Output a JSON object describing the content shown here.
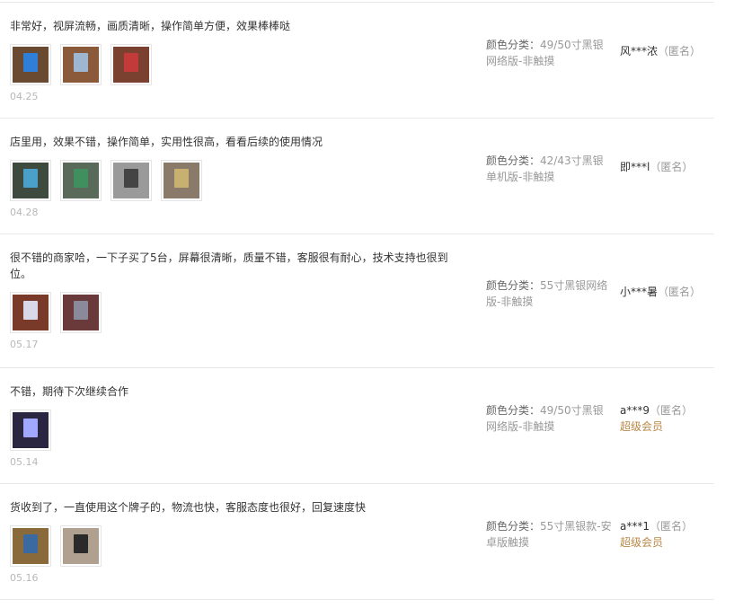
{
  "colors": {
    "vip": "#b98947",
    "meta": "#999999",
    "divider": "#e8e8e8"
  },
  "reviews": [
    {
      "text": "非常好，视屏流畅，画质清晰，操作简单方便，效果棒棒哒",
      "date": "04.25",
      "sku_label": "颜色分类：",
      "sku_value": "49/50寸黑银网络版-非触摸",
      "user": "风***浓",
      "anon": "（匿名）",
      "vip": "",
      "photos": [
        {
          "bg": "#6b4a32",
          "screen": "#2f7fd8"
        },
        {
          "bg": "#8a5a3a",
          "screen": "#9fb6d0"
        },
        {
          "bg": "#7a4030",
          "screen": "#c23a3a"
        }
      ]
    },
    {
      "text": "店里用，效果不错，操作简单，实用性很高，看看后续的使用情况",
      "date": "04.28",
      "sku_label": "颜色分类：",
      "sku_value": "42/43寸黑银单机版-非触摸",
      "user": "即***l",
      "anon": "（匿名）",
      "vip": "",
      "photos": [
        {
          "bg": "#3d4a3d",
          "screen": "#4aa0c8"
        },
        {
          "bg": "#5a6a5a",
          "screen": "#3f8f5f"
        },
        {
          "bg": "#9a9a9a",
          "screen": "#444444"
        },
        {
          "bg": "#8a7a6a",
          "screen": "#c8b070"
        }
      ]
    },
    {
      "text": "很不错的商家哈，一下子买了5台，屏幕很清晰，质量不错，客服很有耐心，技术支持也很到位。",
      "date": "05.17",
      "sku_label": "颜色分类：",
      "sku_value": "55寸黑银网络版-非触摸",
      "user": "小***暑",
      "anon": "（匿名）",
      "vip": "",
      "photos": [
        {
          "bg": "#7a3a2a",
          "screen": "#d8d8e8"
        },
        {
          "bg": "#6a3a3a",
          "screen": "#8a8a9a"
        }
      ]
    },
    {
      "text": "不错，期待下次继续合作",
      "date": "05.14",
      "sku_label": "颜色分类：",
      "sku_value": "49/50寸黑银网络版-非触摸",
      "user": "a***9",
      "anon": "（匿名）",
      "vip": "超级会员",
      "photos": [
        {
          "bg": "#2a2540",
          "screen": "#a0a8ff"
        }
      ]
    },
    {
      "text": "货收到了，一直使用这个牌子的，物流也快，客服态度也很好，回复速度快",
      "date": "05.16",
      "sku_label": "颜色分类：",
      "sku_value": "55寸黑银款-安卓版触摸",
      "user": "a***1",
      "anon": "（匿名）",
      "vip": "超级会员",
      "photos": [
        {
          "bg": "#8a6a3a",
          "screen": "#3a6aa0"
        },
        {
          "bg": "#b0a090",
          "screen": "#2a2a2a"
        }
      ]
    }
  ]
}
